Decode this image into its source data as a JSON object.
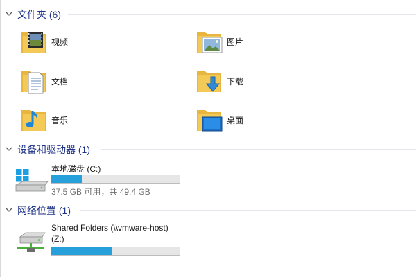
{
  "groups": {
    "folders": {
      "title": "文件夹 (6)"
    },
    "devices": {
      "title": "设备和驱动器 (1)"
    },
    "network": {
      "title": "网络位置 (1)"
    }
  },
  "folders": [
    {
      "label": "视频",
      "icon": "video-folder-icon"
    },
    {
      "label": "图片",
      "icon": "pictures-folder-icon"
    },
    {
      "label": "文档",
      "icon": "documents-folder-icon"
    },
    {
      "label": "下载",
      "icon": "downloads-folder-icon"
    },
    {
      "label": "音乐",
      "icon": "music-folder-icon"
    },
    {
      "label": "桌面",
      "icon": "desktop-folder-icon"
    }
  ],
  "drives": [
    {
      "name": "本地磁盘 (C:)",
      "free_text": "37.5 GB 可用，共 49.4 GB",
      "used_fraction": 0.24,
      "icon": "local-disk-icon"
    }
  ],
  "network_locations": [
    {
      "name_line1": "Shared Folders (\\\\vmware-host)",
      "name_line2": "(Z:)",
      "used_fraction": 0.47,
      "icon": "network-drive-icon"
    }
  ],
  "colors": {
    "group_title": "#1e3287",
    "bar_fill": "#26a0da",
    "bar_track": "#e6e6e6",
    "folder_yellow": "#f3c957"
  }
}
